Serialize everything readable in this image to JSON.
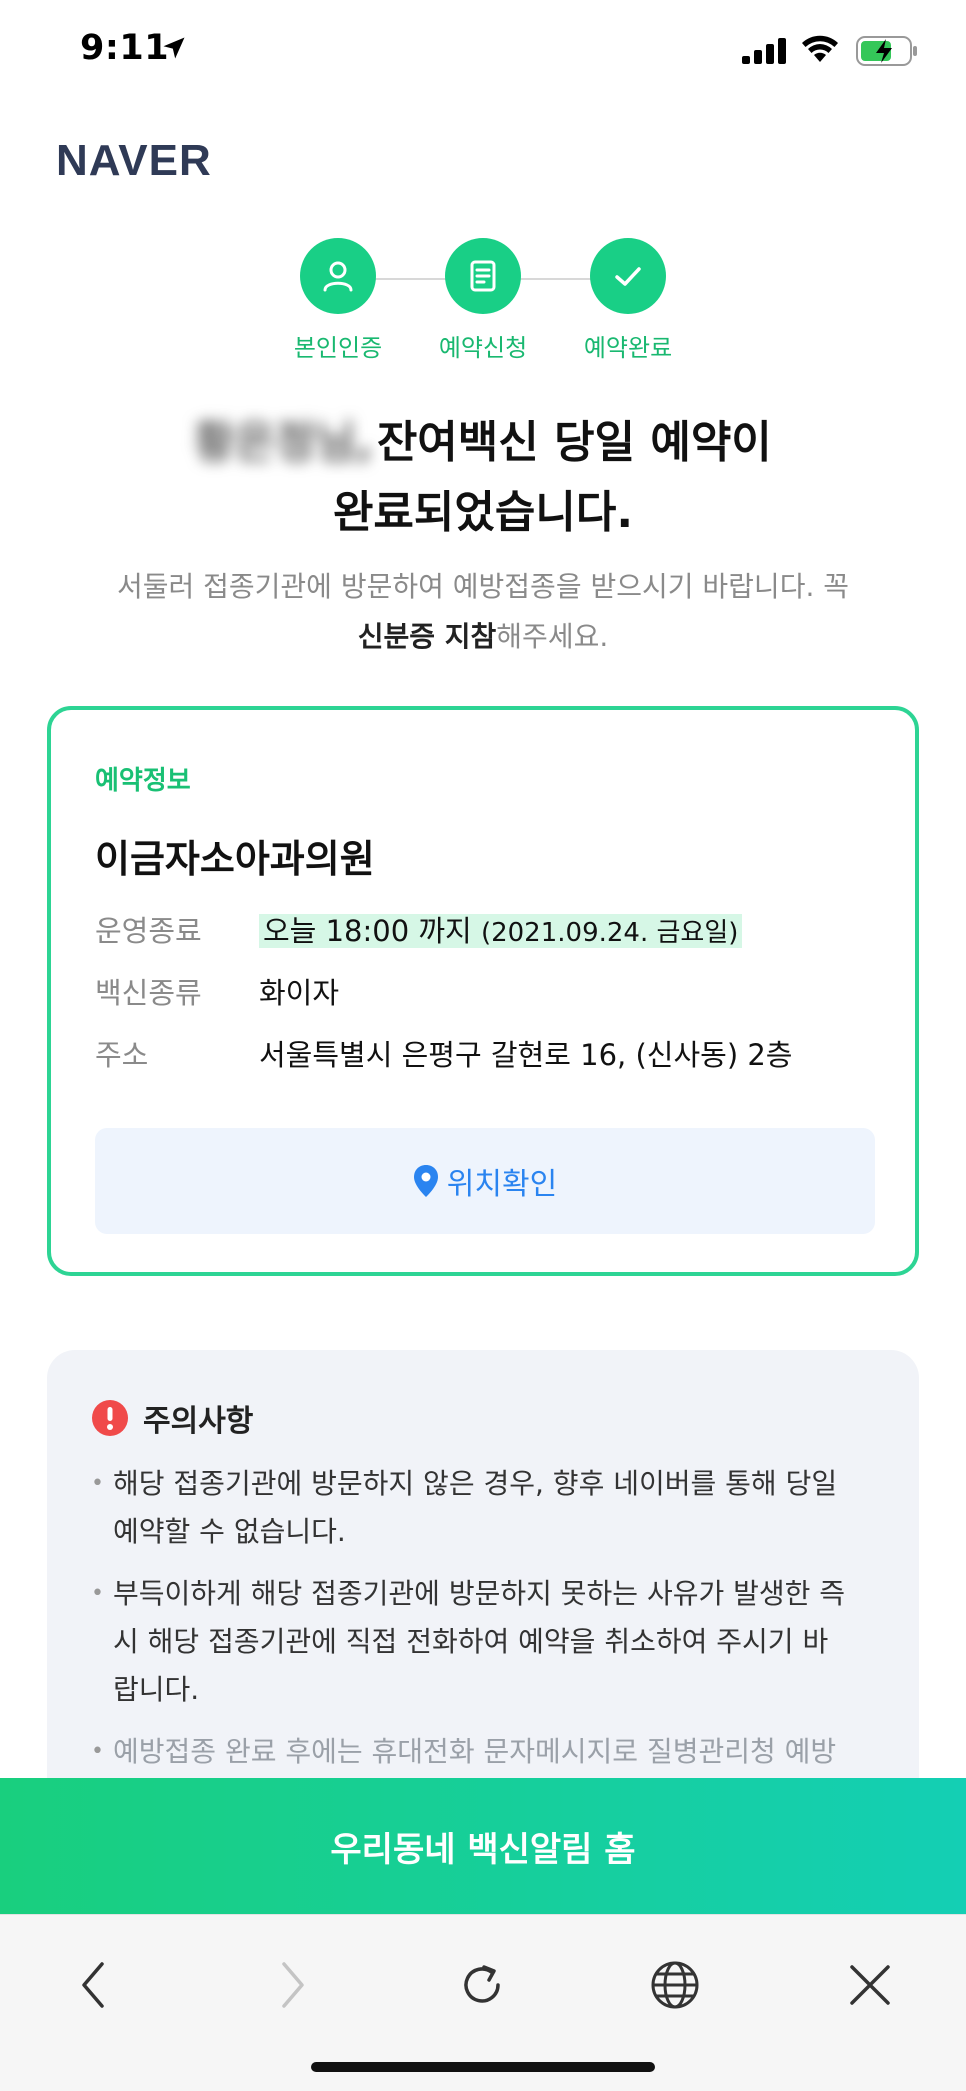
{
  "status_bar": {
    "time": "9:11",
    "icons": [
      "location-arrow-icon",
      "cellular-signal-icon",
      "wifi-icon",
      "battery-charging-icon"
    ]
  },
  "logo": "NAVER",
  "steps": [
    {
      "label": "본인인증",
      "icon": "person-icon"
    },
    {
      "label": "예약신청",
      "icon": "document-icon"
    },
    {
      "label": "예약완료",
      "icon": "check-icon"
    }
  ],
  "heading": {
    "name_blurred": "황은정님,",
    "line1": "잔여백신 당일 예약이",
    "line2": "완료되었습니다."
  },
  "subtext": {
    "line1": "서둘러 접종기관에 방문하여 예방접종을 받으시기 바랍니다. 꼭",
    "strong": "신분증 지참",
    "tail": "해주세요."
  },
  "card": {
    "tag": "예약정보",
    "title": "이금자소아과의원",
    "rows": [
      {
        "label": "운영종료",
        "value_main": "오늘 18:00 까지",
        "value_sub": "(2021.09.24. 금요일)"
      },
      {
        "label": "백신종류",
        "value": "화이자"
      },
      {
        "label": "주소",
        "value": "서울특별시 은평구 갈현로 16, (신사동) 2층"
      }
    ],
    "location_button": "위치확인"
  },
  "notice": {
    "title": "주의사항",
    "items": [
      {
        "line1": "해당 접종기관에 방문하지 않은 경우, 향후 네이버를 통해 당일",
        "line2": "예약할 수 없습니다."
      },
      {
        "line1": "부득이하게 해당 접종기관에 방문하지 못하는 사유가 발생한 즉",
        "line2": "시 해당 접종기관에 직접 전화하여 예약을 취소하여 주시기 바",
        "line3": "랍니다."
      },
      {
        "line1": "예방접종 완료 후에는 휴대전화 문자메시지로 질병관리청 예방"
      }
    ]
  },
  "cta": "우리동네 백신알림 홈",
  "toolbar": [
    "back-icon",
    "forward-icon",
    "reload-icon",
    "globe-icon",
    "close-icon"
  ],
  "colors": {
    "accent_green": "#19cf86",
    "card_border": "#2dd494",
    "link_blue": "#2a84f0",
    "warning_red": "#f04a4a"
  }
}
